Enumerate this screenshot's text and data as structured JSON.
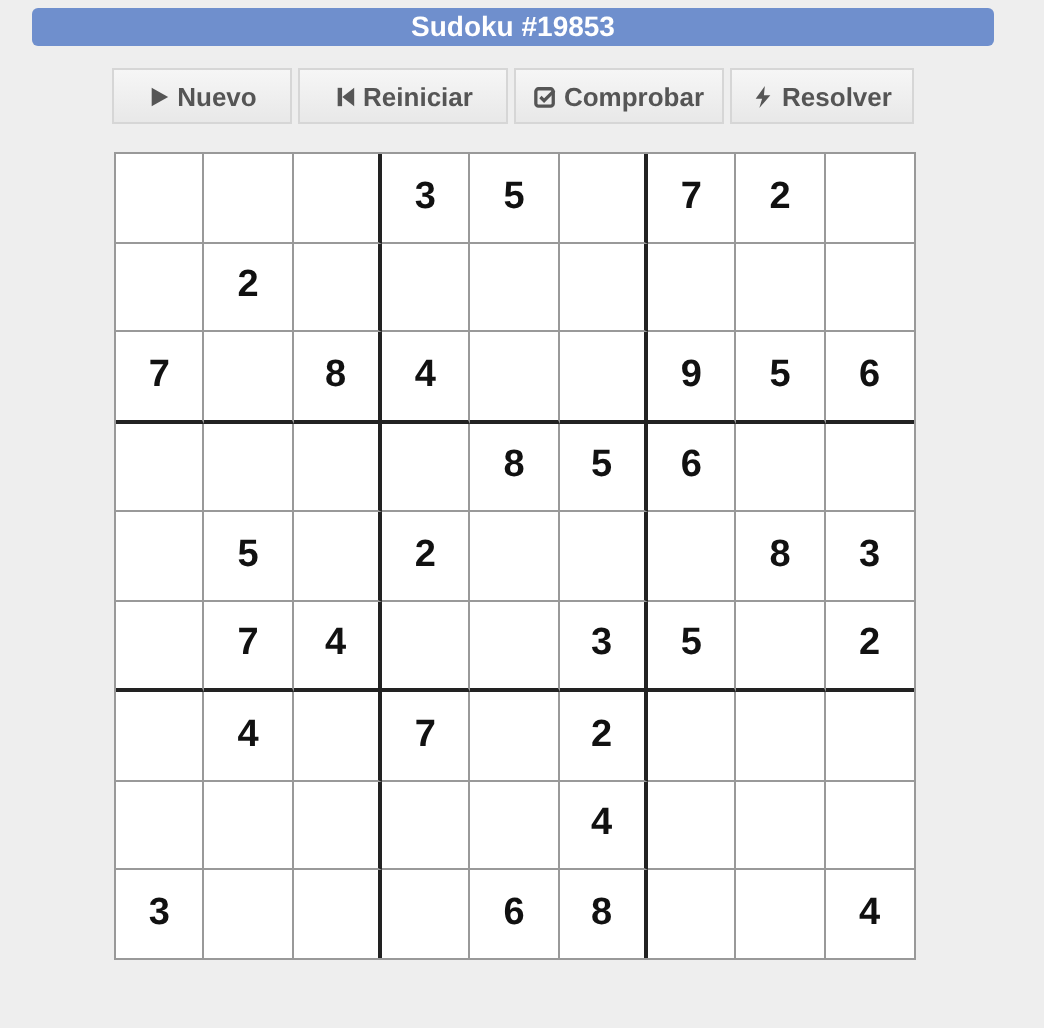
{
  "title": "Sudoku #19853",
  "buttons": [
    {
      "label": "Nuevo",
      "kind": "play"
    },
    {
      "label": "Reiniciar",
      "kind": "restart"
    },
    {
      "label": "Comprobar",
      "kind": "check"
    },
    {
      "label": "Resolver",
      "kind": "bolt"
    }
  ],
  "grid": [
    [
      {
        "kind": "empty"
      },
      {
        "kind": "empty"
      },
      {
        "kind": "empty"
      },
      {
        "kind": "given",
        "digit": "3"
      },
      {
        "kind": "given",
        "digit": "5"
      },
      {
        "kind": "empty"
      },
      {
        "kind": "given",
        "digit": "7"
      },
      {
        "kind": "given",
        "digit": "2"
      },
      {
        "kind": "empty"
      }
    ],
    [
      {
        "kind": "empty"
      },
      {
        "kind": "given",
        "digit": "2"
      },
      {
        "kind": "empty"
      },
      {
        "kind": "empty"
      },
      {
        "kind": "empty"
      },
      {
        "kind": "empty"
      },
      {
        "kind": "empty"
      },
      {
        "kind": "empty"
      },
      {
        "kind": "empty"
      }
    ],
    [
      {
        "kind": "given",
        "digit": "7"
      },
      {
        "kind": "empty"
      },
      {
        "kind": "given",
        "digit": "8"
      },
      {
        "kind": "given",
        "digit": "4"
      },
      {
        "kind": "empty"
      },
      {
        "kind": "empty"
      },
      {
        "kind": "given",
        "digit": "9"
      },
      {
        "kind": "given",
        "digit": "5"
      },
      {
        "kind": "given",
        "digit": "6"
      }
    ],
    [
      {
        "kind": "empty"
      },
      {
        "kind": "empty"
      },
      {
        "kind": "empty"
      },
      {
        "kind": "empty"
      },
      {
        "kind": "given",
        "digit": "8"
      },
      {
        "kind": "given",
        "digit": "5"
      },
      {
        "kind": "given",
        "digit": "6"
      },
      {
        "kind": "empty"
      },
      {
        "kind": "empty"
      }
    ],
    [
      {
        "kind": "empty"
      },
      {
        "kind": "given",
        "digit": "5"
      },
      {
        "kind": "empty"
      },
      {
        "kind": "given",
        "digit": "2"
      },
      {
        "kind": "empty"
      },
      {
        "kind": "empty"
      },
      {
        "kind": "empty"
      },
      {
        "kind": "given",
        "digit": "8"
      },
      {
        "kind": "given",
        "digit": "3"
      }
    ],
    [
      {
        "kind": "empty"
      },
      {
        "kind": "given",
        "digit": "7"
      },
      {
        "kind": "given",
        "digit": "4"
      },
      {
        "kind": "empty"
      },
      {
        "kind": "empty"
      },
      {
        "kind": "given",
        "digit": "3"
      },
      {
        "kind": "given",
        "digit": "5"
      },
      {
        "kind": "empty"
      },
      {
        "kind": "given",
        "digit": "2"
      }
    ],
    [
      {
        "kind": "empty"
      },
      {
        "kind": "given",
        "digit": "4"
      },
      {
        "kind": "empty"
      },
      {
        "kind": "given",
        "digit": "7"
      },
      {
        "kind": "empty"
      },
      {
        "kind": "given",
        "digit": "2"
      },
      {
        "kind": "empty"
      },
      {
        "kind": "empty"
      },
      {
        "kind": "empty"
      }
    ],
    [
      {
        "kind": "empty"
      },
      {
        "kind": "empty"
      },
      {
        "kind": "empty"
      },
      {
        "kind": "empty"
      },
      {
        "kind": "empty"
      },
      {
        "kind": "given",
        "digit": "4"
      },
      {
        "kind": "empty"
      },
      {
        "kind": "empty"
      },
      {
        "kind": "empty"
      }
    ],
    [
      {
        "kind": "given",
        "digit": "3"
      },
      {
        "kind": "empty"
      },
      {
        "kind": "empty"
      },
      {
        "kind": "empty"
      },
      {
        "kind": "given",
        "digit": "6"
      },
      {
        "kind": "given",
        "digit": "8"
      },
      {
        "kind": "empty"
      },
      {
        "kind": "empty"
      },
      {
        "kind": "given",
        "digit": "4"
      }
    ]
  ]
}
